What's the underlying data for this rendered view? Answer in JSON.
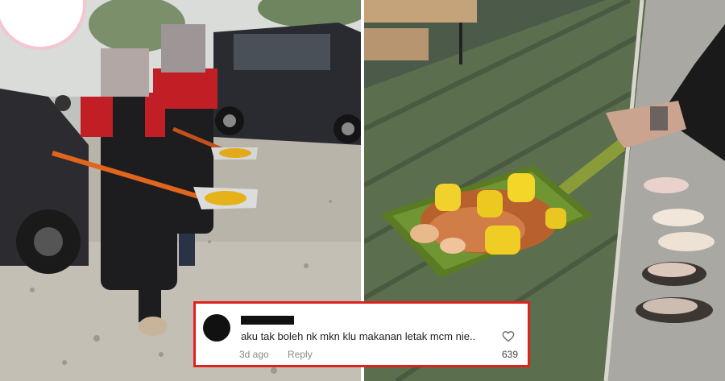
{
  "comment": {
    "text": "aku tak boleh nk mkn klu makanan letak mcm nie..",
    "time_ago": "3d ago",
    "reply_label": "Reply",
    "like_count": "639",
    "username_redacted": true
  },
  "icons": {
    "avatar": "avatar",
    "like": "heart-outline-icon"
  },
  "colors": {
    "highlight_border": "#e0211d",
    "meta_text": "#8a8a8a"
  }
}
